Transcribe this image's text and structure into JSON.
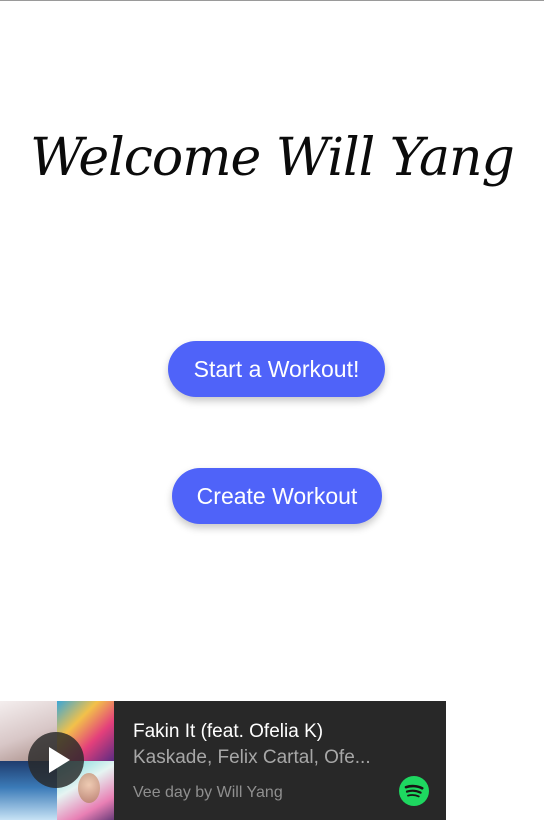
{
  "welcome_title": "Welcome Will Yang",
  "buttons": {
    "start_workout": "Start a Workout!",
    "create_workout": "Create Workout"
  },
  "player": {
    "track_title": "Fakin It (feat. Ofelia K)",
    "track_artists": "Kaskade, Felix Cartal, Ofe...",
    "playlist_line": "Vee day by Will Yang",
    "play_icon": "play-icon",
    "logo_icon": "spotify-icon"
  },
  "colors": {
    "button": "#4f63f9",
    "player_bg": "#282828",
    "spotify_green": "#1ed760"
  }
}
